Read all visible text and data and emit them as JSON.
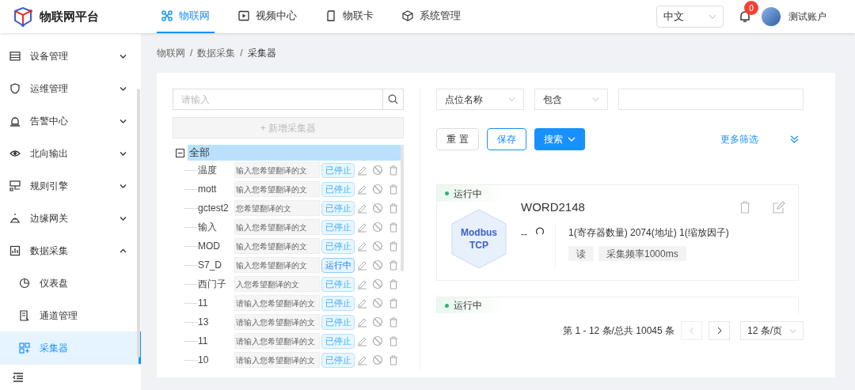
{
  "header": {
    "title": "物联网平台",
    "nav": [
      {
        "label": "物联网",
        "selected": true
      },
      {
        "label": "视频中心",
        "selected": false
      },
      {
        "label": "物联卡",
        "selected": false
      },
      {
        "label": "系统管理",
        "selected": false
      }
    ],
    "language": "中文",
    "notification_count": "0",
    "user": "测试账户"
  },
  "sidebar": {
    "items": [
      {
        "label": "设备管理",
        "expanded": false,
        "selected": false
      },
      {
        "label": "运维管理",
        "expanded": false,
        "selected": false
      },
      {
        "label": "告警中心",
        "expanded": false,
        "selected": false
      },
      {
        "label": "北向输出",
        "expanded": false,
        "selected": false
      },
      {
        "label": "规则引擎",
        "expanded": false,
        "selected": false
      },
      {
        "label": "边缘网关",
        "expanded": false,
        "selected": false
      },
      {
        "label": "数据采集",
        "expanded": true,
        "selected": false,
        "children": [
          {
            "label": "仪表盘",
            "selected": false
          },
          {
            "label": "通道管理",
            "selected": false
          },
          {
            "label": "采集器",
            "selected": true
          }
        ]
      }
    ]
  },
  "breadcrumb": [
    {
      "kind": "link",
      "text": "物联网"
    },
    {
      "kind": "separator",
      "text": "/"
    },
    {
      "kind": "link",
      "text": "数据采集"
    },
    {
      "kind": "separator",
      "text": "/"
    },
    {
      "kind": "current",
      "text": "采集器"
    }
  ],
  "tree": {
    "search_placeholder": "请输入",
    "add_button": "+ 新增采集器",
    "root": {
      "label": "全部",
      "expanded": true,
      "selected": true,
      "children": [
        {
          "name": "温度",
          "placeholder": "输入您希望翻译的文",
          "status": "已停止",
          "running": false
        },
        {
          "name": "mott",
          "placeholder": "输入您希望翻译的文",
          "status": "已停止",
          "running": false
        },
        {
          "name": "gctest2",
          "placeholder": "您希望翻译的文",
          "status": "已停止",
          "running": false
        },
        {
          "name": "输入",
          "placeholder": "输入您希望翻译的文",
          "status": "已停止",
          "running": false
        },
        {
          "name": "MOD",
          "placeholder": "输入您希望翻译的文",
          "status": "已停止",
          "running": false
        },
        {
          "name": "S7_D",
          "placeholder": "输入您希望翻译的文",
          "status": "运行中",
          "running": true
        },
        {
          "name": "西门子",
          "placeholder": "入您希望翻译的文",
          "status": "已停止",
          "running": false
        },
        {
          "name": "11",
          "placeholder": "请输入您希望翻译的文",
          "status": "已停止",
          "running": false
        },
        {
          "name": "13",
          "placeholder": "请输入您希望翻译的文",
          "status": "已停止",
          "running": false
        },
        {
          "name": "11",
          "placeholder": "请输入您希望翻译的文",
          "status": "已停止",
          "running": false
        },
        {
          "name": "10",
          "placeholder": "请输入您希望翻译的文",
          "status": "已停止",
          "running": false
        }
      ]
    }
  },
  "filters": {
    "field": "点位名称",
    "operator": "包含",
    "buttons": {
      "reset": "重 置",
      "save": "保存",
      "search": "搜索"
    },
    "more": "更多筛选"
  },
  "cards": [
    {
      "status": "运行中",
      "name": "WORD2148",
      "protocol_line1": "Modbus",
      "protocol_line2": "TCP",
      "value": "--",
      "details": "1(寄存器数量) 2074(地址) 1(缩放因子)",
      "tags": [
        "读",
        "采集频率1000ms"
      ]
    },
    {
      "status": "运行中"
    }
  ],
  "pagination": {
    "summary": "第 1 - 12 条/总共 10045 条",
    "page_size": "12 条/页"
  }
}
